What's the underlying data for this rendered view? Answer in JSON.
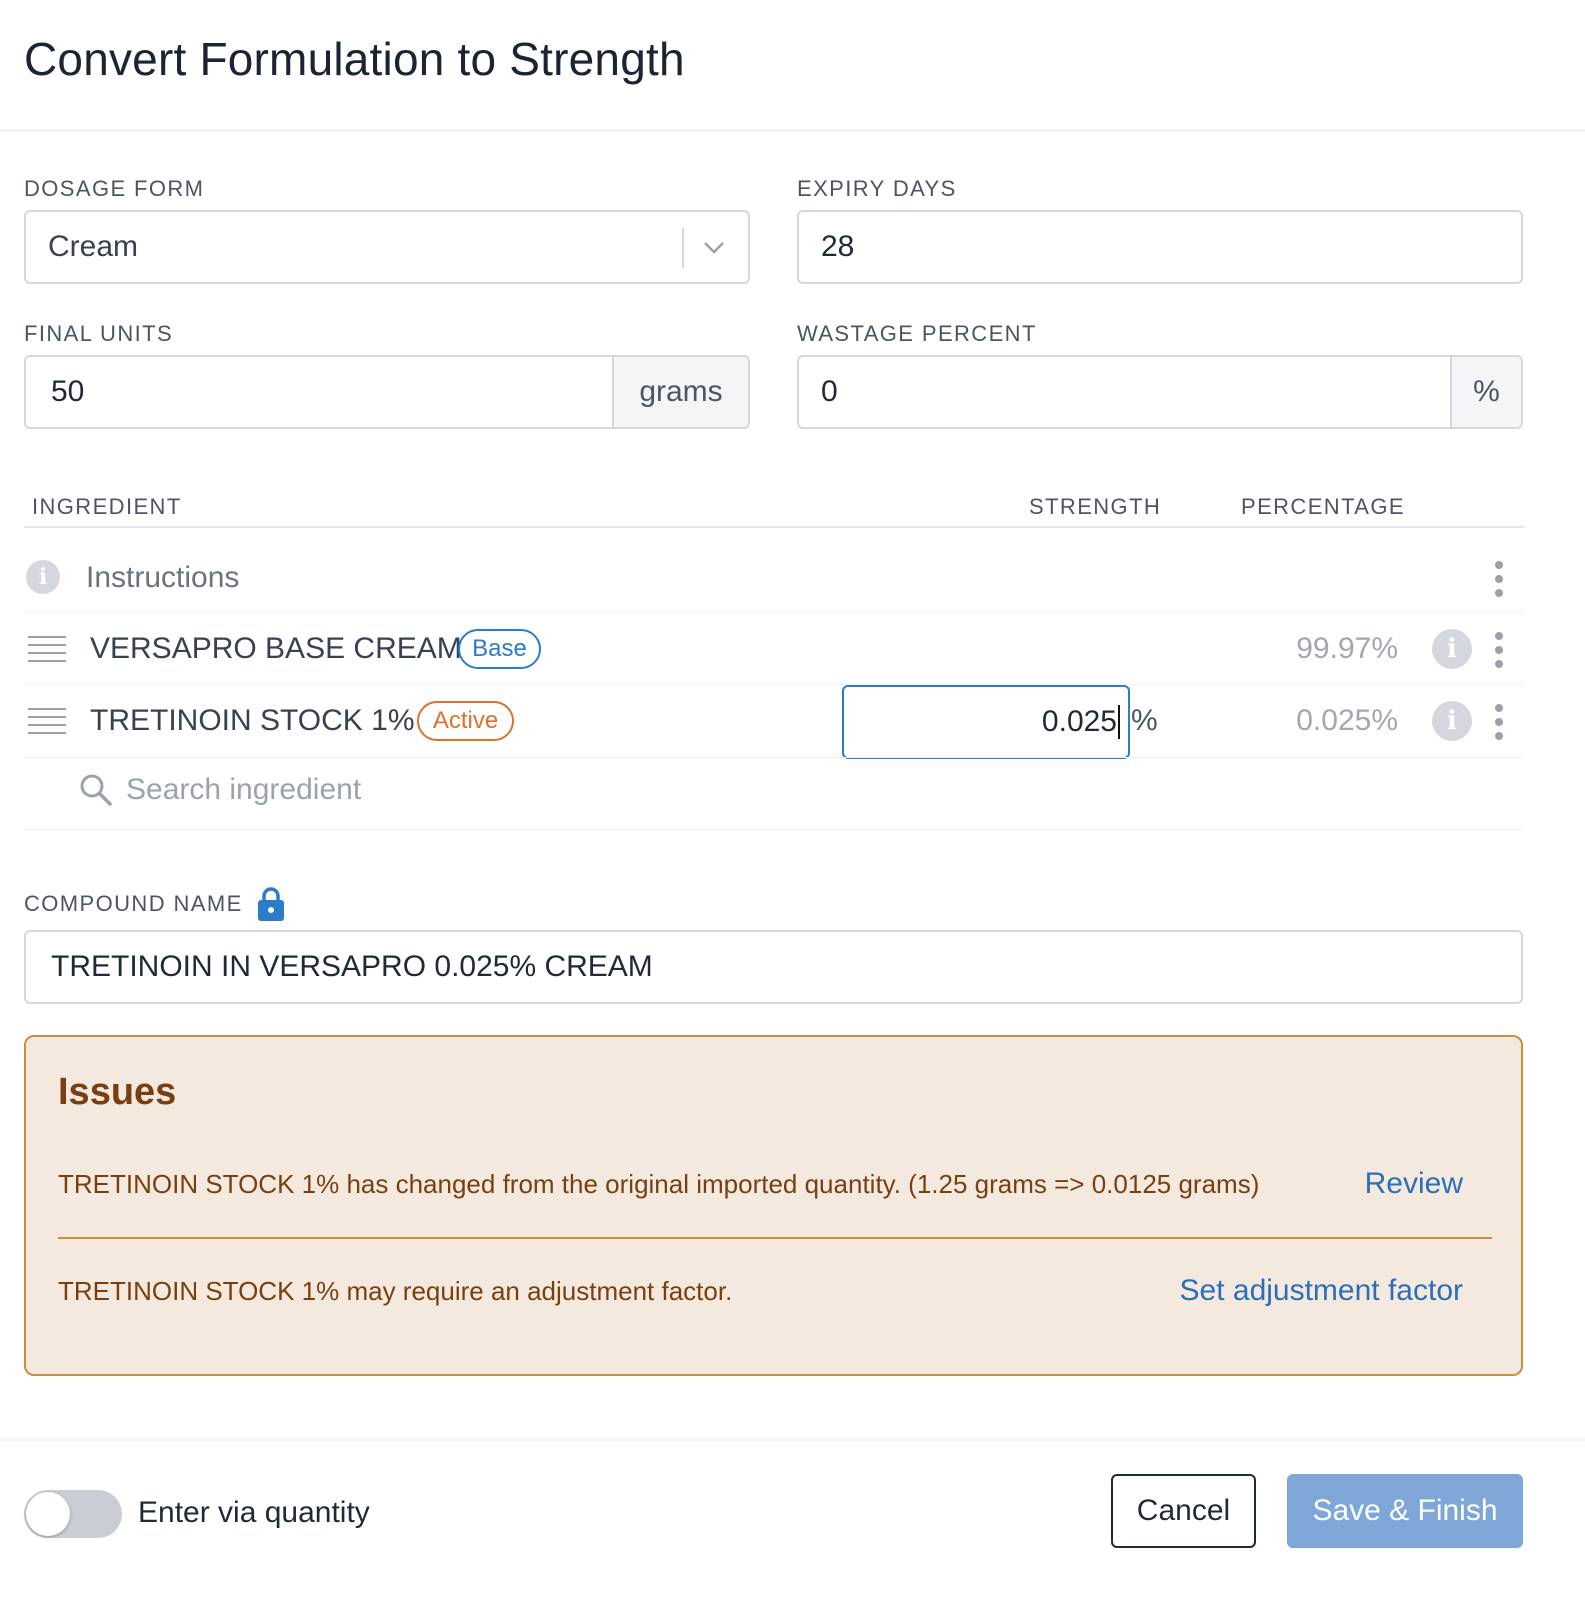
{
  "dialog": {
    "title": "Convert Formulation to Strength"
  },
  "dosage_form": {
    "label": "DOSAGE FORM",
    "value": "Cream"
  },
  "expiry_days": {
    "label": "EXPIRY DAYS",
    "value": "28"
  },
  "final_units": {
    "label": "FINAL UNITS",
    "value": "50",
    "unit": "grams"
  },
  "wastage_percent": {
    "label": "WASTAGE PERCENT",
    "value": "0",
    "unit": "%"
  },
  "ingredients_table": {
    "headers": {
      "ingredient": "INGREDIENT",
      "strength": "STRENGTH",
      "percentage": "PERCENTAGE"
    },
    "instructions_label": "Instructions",
    "rows": [
      {
        "name": "VERSAPRO BASE CREAM",
        "badge": "Base",
        "strength": "",
        "percentage": "99.97%"
      },
      {
        "name": "TRETINOIN STOCK 1%",
        "badge": "Active",
        "strength": "0.025",
        "strength_unit": "%",
        "percentage": "0.025%"
      }
    ],
    "search_placeholder": "Search ingredient"
  },
  "compound_name": {
    "label": "COMPOUND NAME",
    "value": "TRETINOIN IN VERSAPRO 0.025% CREAM",
    "locked": true
  },
  "issues": {
    "title": "Issues",
    "items": [
      {
        "text": "TRETINOIN STOCK 1% has changed from the original imported quantity. (1.25 grams => 0.0125 grams)",
        "action": "Review"
      },
      {
        "text": "TRETINOIN STOCK 1% may require an adjustment factor.",
        "action": "Set adjustment factor"
      }
    ]
  },
  "footer": {
    "toggle_label": "Enter via quantity",
    "toggle_on": false,
    "cancel_label": "Cancel",
    "save_label": "Save & Finish"
  },
  "colors": {
    "accent": "#2b7cc9",
    "active_badge": "#e0702a",
    "issues_bg": "#f4e9de",
    "issues_border": "#c98f3a",
    "save_button": "#7ea7d8"
  }
}
